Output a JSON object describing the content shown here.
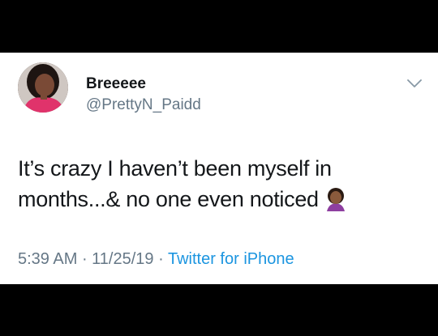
{
  "tweet": {
    "display_name": "Breeeee",
    "handle": "@PrettyN_Paidd",
    "text_line1": "It’s crazy I haven’t been myself in",
    "text_line2": "months...& no one even noticed",
    "emoji": "face-palm-woman-emoji",
    "time": "5:39 AM",
    "separator1": " · ",
    "date": "11/25/19",
    "separator2": " · ",
    "source": "Twitter for iPhone"
  },
  "icons": {
    "menu": "chevron-down-icon",
    "avatar": "avatar"
  },
  "colors": {
    "background": "#000000",
    "card": "#ffffff",
    "text": "#14171a",
    "secondary": "#657786",
    "link": "#1b95e0"
  }
}
